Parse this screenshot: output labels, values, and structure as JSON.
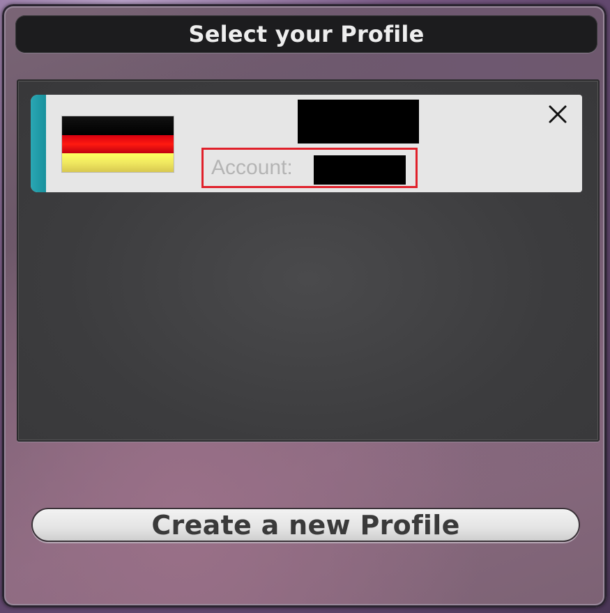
{
  "dialog": {
    "title": "Select your Profile"
  },
  "profiles": [
    {
      "flag": "germany-flag",
      "account_label": "Account:",
      "close_icon": "close-icon"
    }
  ],
  "actions": {
    "create_label": "Create a new Profile"
  },
  "colors": {
    "accent": "#1aa0ac",
    "highlight": "#e0202a"
  }
}
